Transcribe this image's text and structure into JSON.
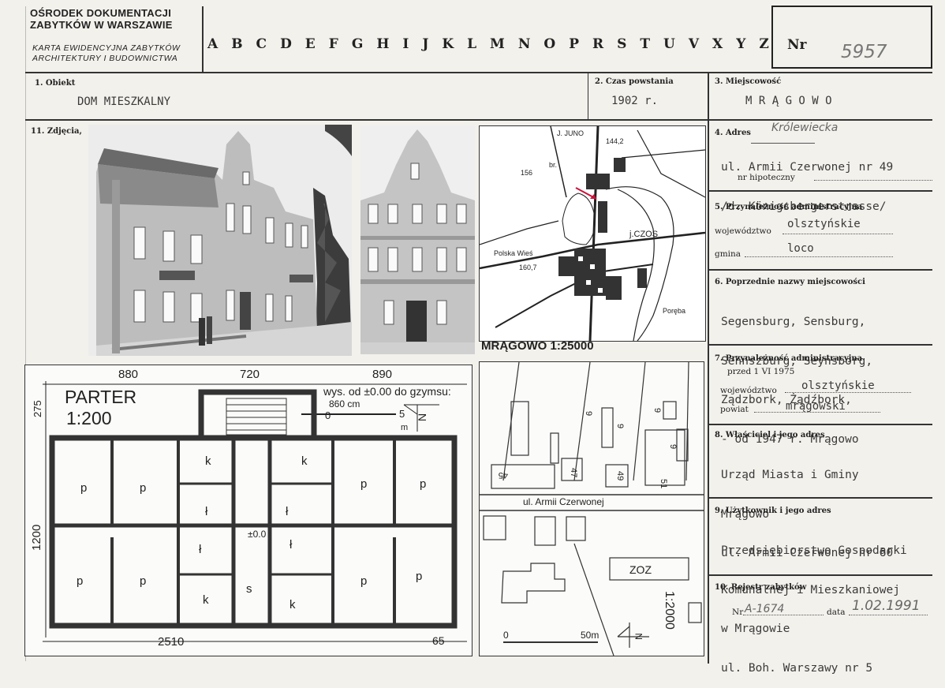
{
  "header": {
    "org_line1": "OŚRODEK DOKUMENTACJI",
    "org_line2": "ZABYTKÓW W WARSZAWIE",
    "card_line1": "KARTA EWIDENCYJNA ZABYTKÓW",
    "card_line2": "ARCHITEKTURY I BUDOWNICTWA",
    "letters": [
      "A",
      "B",
      "C",
      "D",
      "E",
      "F",
      "G",
      "H",
      "I",
      "J",
      "K",
      "L",
      "M",
      "N",
      "O",
      "P",
      "R",
      "S",
      "T",
      "U",
      "V",
      "X",
      "Y",
      "Z"
    ],
    "nr_label": "Nr",
    "nr_value": "5957"
  },
  "fields": {
    "obiekt_label": "1. Obiekt",
    "obiekt_value": "DOM MIESZKALNY",
    "czas_label": "2. Czas powstania",
    "czas_value": "1902 r.",
    "miejscowosc_label": "3. Miejscowość",
    "miejscowosc_value": "M R Ą G O W O",
    "zdjecia_label": "11. Zdjęcia,",
    "adres_label": "4. Adres",
    "adres_hand": "Królewiecka",
    "adres_line1": "ul. Armii Czerwonej nr 49",
    "adres_line2": "/d. Königsbergerstrasse/",
    "hipoteczny_label": "nr hipoteczny",
    "przynal_label": "5. Przynależność administracyjna",
    "woj_label": "województwo",
    "woj_value": "olsztyńskie",
    "gmina_label": "gmina",
    "gmina_value": "loco",
    "poprz_label": "6. Poprzednie nazwy miejscowości",
    "poprz_lines": [
      "Segensburg, Sensburg,",
      "Sehnszburg, Seynsborg,",
      "Ządzbork, Żądźbork,",
      "- od 1947 r. Mrągowo"
    ],
    "przynal7_label": "7. Przynależność administracyjna",
    "przed_label": "przed 1 VI 1975",
    "woj7_label": "województwo",
    "woj7_value": "olsztyńskie",
    "powiat_label": "powiat",
    "powiat_value": "mrągowski",
    "wlasciciel_label": "8. Właściciel i jego adres",
    "wlasciciel_lines": [
      "Urząd Miasta i Gminy",
      "Mrągowo",
      "ul. Armii Czerwonej nr 60"
    ],
    "uzytkownik_label": "9. Użytkownik i jego adres",
    "uzytkownik_lines": [
      "Przedsiębiorstwo Gospodarki",
      "Komunalnej i Mieszkaniowej",
      "w Mrągowie",
      "ul. Boh. Warszawy nr 5"
    ],
    "rejestr_label": "10. Rejestr zabytków",
    "rejestr_nr_label": "Nr",
    "rejestr_nr_value": "A-1674",
    "data_label": "data",
    "data_value": "1.02.1991"
  },
  "map": {
    "caption": "MRĄGOWO 1:25000",
    "labels": {
      "juno": "J. JUNO",
      "czos": "j.CZOS",
      "polska_wies": "Polska Wieś",
      "poreba": "Poręba",
      "h156": "156",
      "h1442": "144,2",
      "h1607": "160,7",
      "br": "br."
    }
  },
  "floorplan": {
    "title": "PARTER",
    "scale": "1:200",
    "height_note_1": "wys. od ±0.00 do gzymsu:",
    "height_note_2": "860 cm",
    "scale_0": "0",
    "scale_5": "5",
    "scale_m": "m",
    "north": "N",
    "dims_top": [
      "880",
      "720",
      "890"
    ],
    "dim_left_top": "275",
    "dim_left": "1200",
    "dim_bottom": "2510",
    "dim_bottom_right": "65",
    "level": "±0.0",
    "rooms": {
      "p": "p",
      "k": "k",
      "l": "ł",
      "s": "s"
    }
  },
  "siteplan": {
    "street": "ul. Armii Czerwonej",
    "zoz": "ZOZ",
    "scale": "1:2000",
    "bar_0": "0",
    "bar_50": "50m",
    "north": "N",
    "nums": [
      "45",
      "47",
      "49",
      "51",
      "9",
      "9",
      "9",
      "9"
    ]
  }
}
